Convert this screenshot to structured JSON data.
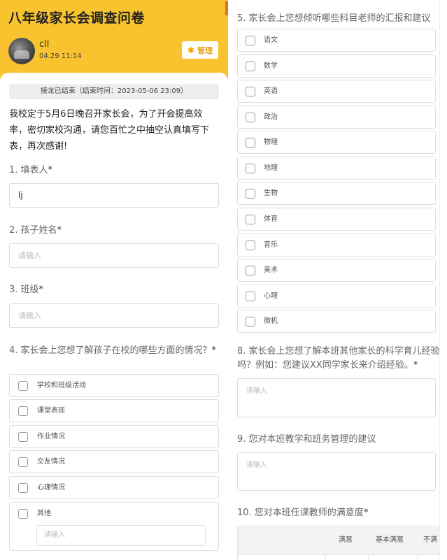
{
  "header": {
    "title": "八年级家长会调查问卷",
    "user_name": "cll",
    "user_time": "04.29 11:14",
    "manage_label": "管理",
    "brand_color": "#F8C32E"
  },
  "status": "接龙已结束（结束时间：2023-05-06 23:09）",
  "intro": "我校定于5月6日晚召开家长会，为了开会提高效率，密切家校沟通，请您百忙之中抽空认真填写下表，再次感谢!",
  "questions": {
    "q1": {
      "label": "1. 填表人",
      "required": "*",
      "value": "lj"
    },
    "q2": {
      "label": "2. 孩子姓名",
      "required": "*",
      "placeholder": "请输入"
    },
    "q3": {
      "label": "3. 班级",
      "required": "*",
      "placeholder": "请输入"
    },
    "q4": {
      "label": "4. 家长会上您想了解孩子在校的哪些方面的情况？",
      "required": "*",
      "options": [
        "学校和班级活动",
        "课堂表现",
        "作业情况",
        "交友情况",
        "心理情况",
        "其他"
      ],
      "other_placeholder": "请输入"
    },
    "q5": {
      "label": "5. 家长会上您想倾听哪些科目老师的汇报和建议",
      "options": [
        "语文",
        "数学",
        "英语",
        "政治",
        "物理",
        "地理",
        "生物",
        "体育",
        "音乐",
        "美术",
        "心理",
        "微机"
      ]
    },
    "q8": {
      "label": "8. 家长会上您想了解本班其他家长的科学育儿经验吗？例如：您建议XX同学家长来介绍经验。",
      "required": "*",
      "placeholder": "请输入"
    },
    "q9": {
      "label": "9. 您对本班教学和班务管理的建议",
      "placeholder": "请输入"
    },
    "q10": {
      "label": "10. 您对本班任课教师的满意度",
      "required": "*",
      "columns": [
        "满意",
        "基本满意",
        "不满"
      ]
    }
  }
}
